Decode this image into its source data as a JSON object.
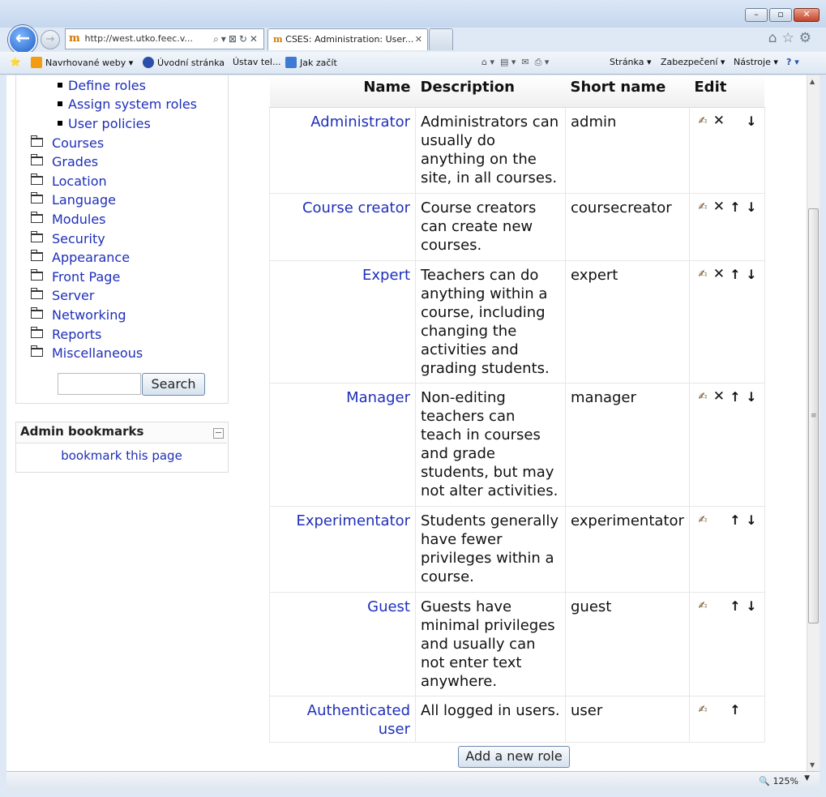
{
  "browser": {
    "address_url": "http://west.utko.feec.v...",
    "active_tab_title": "CSES: Administration: User...",
    "favorites": [
      {
        "label": "Navrhované weby ▾"
      },
      {
        "label": "Úvodní stránka"
      },
      {
        "label": "Ústav tel..."
      },
      {
        "label": "Jak začít"
      }
    ],
    "commandbar": {
      "page_menu": "Stránka ▾",
      "security_menu": "Zabezpečení ▾",
      "tools_menu": "Nástroje ▾"
    },
    "zoom": "125%"
  },
  "sidebar": {
    "sub_items": [
      "Define roles",
      "Assign system roles",
      "User policies"
    ],
    "folders": [
      "Courses",
      "Grades",
      "Location",
      "Language",
      "Modules",
      "Security",
      "Appearance",
      "Front Page",
      "Server",
      "Networking",
      "Reports",
      "Miscellaneous"
    ],
    "search_button": "Search",
    "bookmarks": {
      "title": "Admin bookmarks",
      "link": "bookmark this page"
    }
  },
  "roles_table": {
    "headers": {
      "name": "Name",
      "description": "Description",
      "short_name": "Short name",
      "edit": "Edit"
    },
    "rows": [
      {
        "name": "Administrator",
        "description": "Administrators can usually do anything on the site, in all courses.",
        "short_name": "admin"
      },
      {
        "name": "Course creator",
        "description": "Course creators can create new courses.",
        "short_name": "coursecreator"
      },
      {
        "name": "Expert",
        "description": "Teachers can do anything within a course, including changing the activities and grading students.",
        "short_name": "expert"
      },
      {
        "name": "Manager",
        "description": "Non-editing teachers can teach in courses and grade students, but may not alter activities.",
        "short_name": "manager"
      },
      {
        "name": "Experimentator",
        "description": "Students generally have fewer privileges within a course.",
        "short_name": "experimentator"
      },
      {
        "name": "Guest",
        "description": "Guests have minimal privileges and usually can not enter text anywhere.",
        "short_name": "guest"
      },
      {
        "name": "Authenticated user",
        "description": "All logged in users.",
        "short_name": "user"
      }
    ]
  },
  "add_role_button": "Add a new role"
}
